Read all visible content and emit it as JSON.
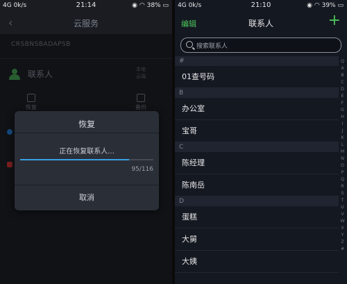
{
  "left": {
    "status": {
      "signal": "4G",
      "speed": "0k/s",
      "time": "21:14",
      "battery": "38%"
    },
    "header": {
      "title": "云服务"
    },
    "account": "CRSBNSBADAPSB",
    "contact_row": {
      "label": "联系人",
      "meta_line1": "本地",
      "meta_line2": "云端"
    },
    "ops": {
      "restore": "恢复",
      "backup": "备份"
    },
    "dialog": {
      "title": "恢复",
      "message": "正在恢复联系人...",
      "progress": 0.819,
      "count": "95/116",
      "cancel": "取消"
    }
  },
  "right": {
    "status": {
      "signal": "4G",
      "speed": "0k/s",
      "time": "21:10",
      "battery": "39%"
    },
    "header": {
      "edit": "编辑",
      "title": "联系人",
      "add": "+"
    },
    "search": {
      "placeholder": "搜索联系人"
    },
    "sections": [
      {
        "letter": "#",
        "items": [
          "01查号码"
        ]
      },
      {
        "letter": "B",
        "items": [
          "办公室",
          "宝哥"
        ]
      },
      {
        "letter": "C",
        "items": [
          "陈经理",
          "陈南岳"
        ]
      },
      {
        "letter": "D",
        "items": [
          "蛋糕",
          "大舅",
          "大姨"
        ]
      }
    ],
    "index": [
      "Q",
      "A",
      "B",
      "C",
      "D",
      "E",
      "F",
      "G",
      "H",
      "I",
      "J",
      "K",
      "L",
      "M",
      "N",
      "O",
      "P",
      "Q",
      "R",
      "S",
      "T",
      "U",
      "V",
      "W",
      "X",
      "Y",
      "Z",
      "#"
    ]
  },
  "colors": {
    "accent_green": "#4cc45a",
    "progress_blue": "#3aa0e6"
  }
}
